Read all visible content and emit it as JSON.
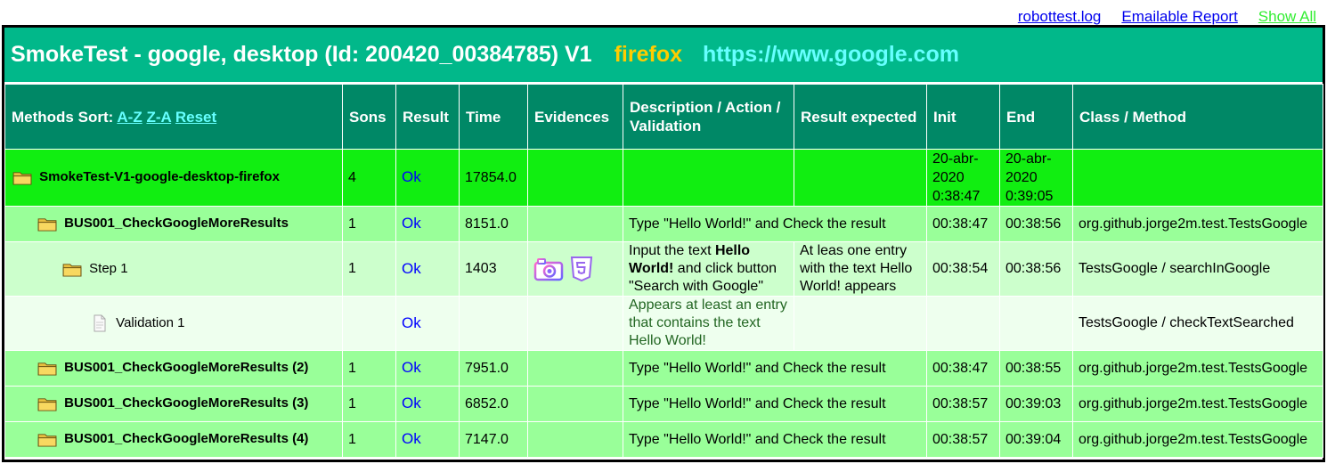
{
  "toplinks": {
    "log": "robottest.log",
    "emailable": "Emailable Report",
    "showall": "Show All"
  },
  "title": {
    "main": "SmokeTest - google, desktop (Id: 200420_00384785) V1",
    "browser": "firefox",
    "url": "https://www.google.com"
  },
  "headers": {
    "methods_sort": "Methods Sort:",
    "az": "A-Z",
    "za": "Z-A",
    "reset": "Reset",
    "sons": "Sons",
    "result": "Result",
    "time": "Time",
    "evidences": "Evidences",
    "description": "Description / Action / Validation",
    "expected": "Result expected",
    "init": "Init",
    "end": "End",
    "class": "Class / Method"
  },
  "suite": {
    "name": "SmokeTest-V1-google-desktop-firefox",
    "sons": "4",
    "result": "Ok",
    "time": "17854.0",
    "init": [
      "20-abr-",
      "2020",
      "0:38:47"
    ],
    "end": [
      "20-abr-",
      "2020",
      "0:39:05"
    ]
  },
  "tests": [
    {
      "name": "BUS001_CheckGoogleMoreResults",
      "sons": "1",
      "result": "Ok",
      "time": "8151.0",
      "description": "Type \"Hello World!\" and Check the result",
      "init": "00:38:47",
      "end": "00:38:56",
      "class": "org.github.jorge2m.test.TestsGoogle"
    },
    {
      "name": "BUS001_CheckGoogleMoreResults (2)",
      "sons": "1",
      "result": "Ok",
      "time": "7951.0",
      "description": "Type \"Hello World!\" and Check the result",
      "init": "00:38:47",
      "end": "00:38:55",
      "class": "org.github.jorge2m.test.TestsGoogle"
    },
    {
      "name": "BUS001_CheckGoogleMoreResults (3)",
      "sons": "1",
      "result": "Ok",
      "time": "6852.0",
      "description": "Type \"Hello World!\" and Check the result",
      "init": "00:38:57",
      "end": "00:39:03",
      "class": "org.github.jorge2m.test.TestsGoogle"
    },
    {
      "name": "BUS001_CheckGoogleMoreResults (4)",
      "sons": "1",
      "result": "Ok",
      "time": "7147.0",
      "description": "Type \"Hello World!\" and Check the result",
      "init": "00:38:57",
      "end": "00:39:04",
      "class": "org.github.jorge2m.test.TestsGoogle"
    }
  ],
  "step": {
    "name": "Step 1",
    "sons": "1",
    "result": "Ok",
    "time": "1403",
    "desc_pre": "Input the text ",
    "desc_bold": "Hello World!",
    "desc_post": " and click button \"Search with Google\"",
    "expected": "At leas one entry with the text Hello World! appears",
    "init": "00:38:54",
    "end": "00:38:56",
    "class": "TestsGoogle / searchInGoogle",
    "evidences": [
      "camera-icon",
      "html5-icon"
    ]
  },
  "validation": {
    "name": "Validation 1",
    "result": "Ok",
    "description": "Appears at least an entry that contains the text Hello World!",
    "class": "TestsGoogle / checkTextSearched"
  },
  "colors": {
    "title_bg": "#01b88a",
    "header_bg": "#008866",
    "suite_bg": "#11ee11",
    "test_bg": "#99ff99",
    "step_bg": "#ccffcc",
    "validation_bg": "#eeffee",
    "browser_text": "#ffcc00",
    "url_text": "#66ffff"
  }
}
